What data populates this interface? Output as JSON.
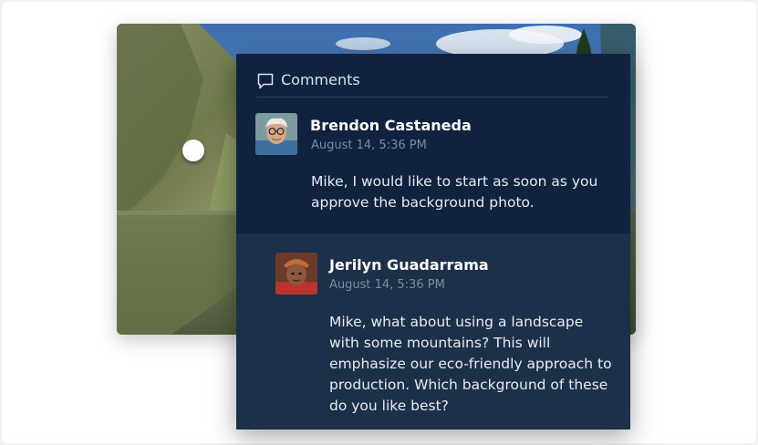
{
  "panel": {
    "title": "Comments",
    "icon": "speech-bubble-icon"
  },
  "comments": [
    {
      "author": "Brendon Castaneda",
      "time": "August 14, 5:36 PM",
      "text": "Mike, I would like to start as soon as you approve the background photo."
    },
    {
      "author": "Jerilyn Guadarrama",
      "time": "August 14, 5:36 PM",
      "text": "Mike, what about using a landscape with some mountains? This will emphasize our eco-friendly approach to production. Which background of these do you like best?"
    }
  ],
  "colors": {
    "panel_bg": "#10223d",
    "reply_bg": "#1d3049",
    "author_text": "#ffffff",
    "time_text": "#7d8ca0"
  }
}
